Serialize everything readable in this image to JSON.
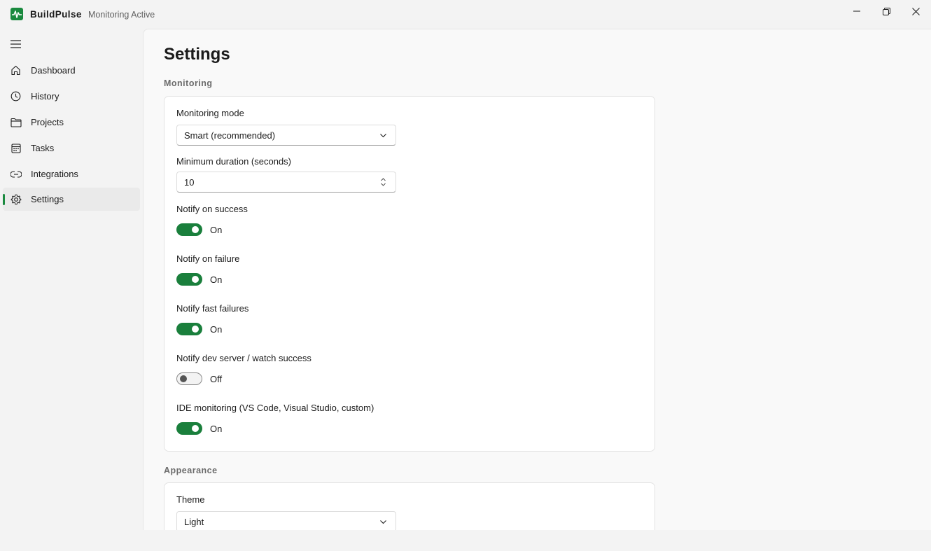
{
  "app": {
    "name": "BuildPulse",
    "status": "Monitoring Active",
    "logo_icon": "pulse-logo-icon",
    "accent_color": "#1a7f3c"
  },
  "window_controls": {
    "minimize_icon": "minimize-icon",
    "restore_icon": "restore-icon",
    "close_icon": "close-icon"
  },
  "sidebar": {
    "menu_icon": "hamburger-icon",
    "items": [
      {
        "label": "Dashboard",
        "icon": "home-icon",
        "active": false
      },
      {
        "label": "History",
        "icon": "clock-icon",
        "active": false
      },
      {
        "label": "Projects",
        "icon": "folder-icon",
        "active": false
      },
      {
        "label": "Tasks",
        "icon": "calendar-icon",
        "active": false
      },
      {
        "label": "Integrations",
        "icon": "link-icon",
        "active": false
      },
      {
        "label": "Settings",
        "icon": "gear-icon",
        "active": true
      }
    ]
  },
  "page": {
    "title": "Settings",
    "monitoring": {
      "header": "Monitoring",
      "mode_label": "Monitoring mode",
      "mode_value": "Smart (recommended)",
      "duration_label": "Minimum duration (seconds)",
      "duration_value": "10",
      "toggles": [
        {
          "label": "Notify on success",
          "state": "On",
          "on": true
        },
        {
          "label": "Notify on failure",
          "state": "On",
          "on": true
        },
        {
          "label": "Notify fast failures",
          "state": "On",
          "on": true
        },
        {
          "label": "Notify dev server / watch success",
          "state": "Off",
          "on": false
        },
        {
          "label": "IDE monitoring (VS Code, Visual Studio, custom)",
          "state": "On",
          "on": true
        }
      ]
    },
    "appearance": {
      "header": "Appearance",
      "theme_label": "Theme",
      "theme_value": "Light"
    }
  }
}
